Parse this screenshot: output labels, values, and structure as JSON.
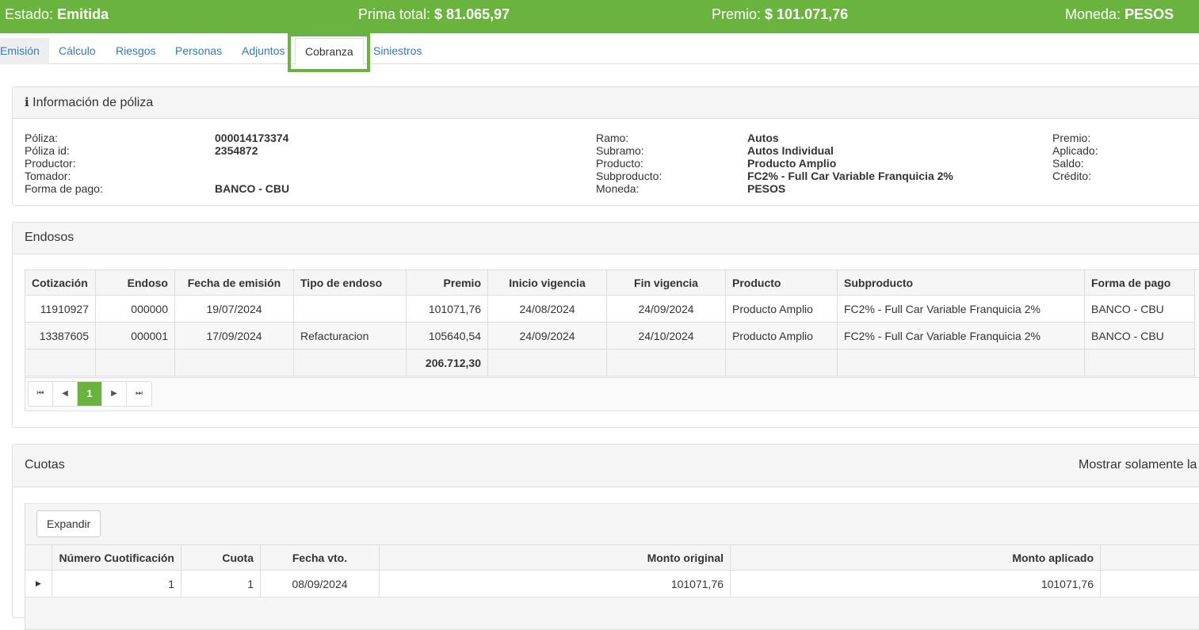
{
  "topbar": {
    "estado_label": "Estado:",
    "estado_value": "Emitida",
    "prima_label": "Prima total:",
    "prima_value": "$ 81.065,97",
    "premio_label": "Premio:",
    "premio_value": "$ 101.071,76",
    "moneda_label": "Moneda:",
    "moneda_value": "PESOS"
  },
  "tabs": [
    "Emisión",
    "Cálculo",
    "Riesgos",
    "Personas",
    "Adjuntos",
    "Cobranza",
    "Siniestros"
  ],
  "info": {
    "title": "Información de póliza",
    "left": [
      {
        "label": "Póliza:",
        "value": "000014173374"
      },
      {
        "label": "Póliza id:",
        "value": "2354872"
      },
      {
        "label": "Productor:",
        "value": ""
      },
      {
        "label": "Tomador:",
        "value": ""
      },
      {
        "label": "Forma de pago:",
        "value": "BANCO - CBU"
      }
    ],
    "middle": [
      {
        "label": "Ramo:",
        "value": "Autos"
      },
      {
        "label": "Subramo:",
        "value": "Autos Individual"
      },
      {
        "label": "Producto:",
        "value": "Producto Amplio"
      },
      {
        "label": "Subproducto:",
        "value": "FC2% - Full Car Variable Franquicia 2%"
      },
      {
        "label": "Moneda:",
        "value": "PESOS"
      }
    ],
    "right": [
      {
        "label": "Premio:"
      },
      {
        "label": "Aplicado:"
      },
      {
        "label": "Saldo:"
      },
      {
        "label": "Crédito:"
      }
    ]
  },
  "endosos": {
    "title": "Endosos",
    "headers": [
      "Cotización",
      "Endoso",
      "Fecha de emisión",
      "Tipo de endoso",
      "Premio",
      "Inicio vigencia",
      "Fin vigencia",
      "Producto",
      "Subproducto",
      "Forma de pago"
    ],
    "rows": [
      [
        "11910927",
        "000000",
        "19/07/2024",
        "",
        "101071,76",
        "24/08/2024",
        "24/09/2024",
        "Producto Amplio",
        "FC2% - Full Car Variable Franquicia 2%",
        "BANCO - CBU"
      ],
      [
        "13387605",
        "000001",
        "17/09/2024",
        "Refacturacion",
        "105640,54",
        "24/09/2024",
        "24/10/2024",
        "Producto Amplio",
        "FC2% - Full Car Variable Franquicia 2%",
        "BANCO - CBU"
      ]
    ],
    "total": "206.712,30",
    "current_page": "1"
  },
  "cuotas": {
    "title": "Cuotas",
    "filter_text": "Mostrar solamente la",
    "expand_label": "Expandir",
    "headers": [
      "Número Cuotificación",
      "Cuota",
      "Fecha vto.",
      "Monto original",
      "Monto aplicado"
    ],
    "rows": [
      [
        "1",
        "1",
        "08/09/2024",
        "101071,76",
        "101071,76"
      ]
    ]
  }
}
